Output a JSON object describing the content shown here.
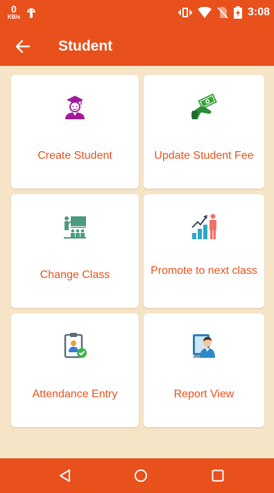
{
  "status_bar": {
    "net_speed": "0",
    "net_unit": "KB/s",
    "time": "3:08",
    "icons": [
      "android-icon",
      "vibrate-icon",
      "wifi-icon",
      "no-sim-icon",
      "battery-charging-icon"
    ]
  },
  "app_bar": {
    "back_icon": "arrow-left-icon",
    "title": "Student"
  },
  "menu": [
    {
      "label": "Create Student",
      "icon": "graduate-icon"
    },
    {
      "label": "Update Student Fee",
      "icon": "money-hand-icon"
    },
    {
      "label": "Change Class",
      "icon": "classroom-icon"
    },
    {
      "label": "Promote to next class",
      "icon": "growth-chart-icon"
    },
    {
      "label": "Attendance Entry",
      "icon": "clipboard-check-icon"
    },
    {
      "label": "Report View",
      "icon": "report-user-icon"
    }
  ],
  "nav_bar": {
    "buttons": [
      "back-triangle-icon",
      "home-circle-icon",
      "recents-square-icon"
    ]
  },
  "colors": {
    "primary": "#e8501c",
    "background": "#f6e4c6",
    "card": "#ffffff"
  }
}
